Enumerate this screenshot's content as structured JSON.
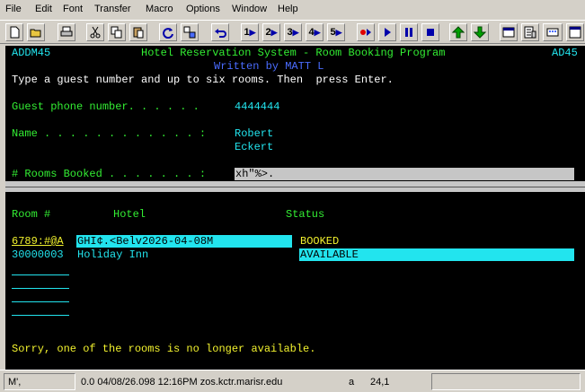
{
  "menu": [
    "File",
    "Edit",
    "Font",
    "Transfer",
    "Macro",
    "Options",
    "Window",
    "Help"
  ],
  "toolbar": {
    "macro_buttons": [
      "1",
      "2",
      "3",
      "4",
      "5"
    ]
  },
  "terminal": {
    "screen_id_left": "ADDM45",
    "title": "Hotel Reservation System - Room Booking Program",
    "screen_id_right": "AD45",
    "author": "Written by MATT L",
    "instruction": "Type a guest number and up to six rooms. Then  press Enter.",
    "guest_phone_label": "Guest phone number. . . . . .",
    "guest_phone_value": "4444444",
    "name_label": "Name . . . . . . . . . . . . :",
    "name_first": "Robert",
    "name_last": "Eckert",
    "rooms_booked_label": "# Rooms Booked . . . . . . . :",
    "rooms_booked_value": "xh\"%>.",
    "col_room": "Room #",
    "col_hotel": "Hotel",
    "col_status": "Status",
    "rows": [
      {
        "room": "6789:#@A",
        "hotel": "GHI¢.<Belv2026-04-08M",
        "status": "BOOKED"
      },
      {
        "room": "30000003",
        "hotel": "Holiday Inn",
        "status": "AVAILABLE"
      }
    ],
    "message": "Sorry, one of the rooms is no longer available."
  },
  "status_bar": {
    "mode": "M',",
    "session_info": "0.0 04/08/26.098 12:16PM zos.kctr.marisr.edu",
    "keyboard": "a",
    "cursor": "24,1"
  },
  "colors": {
    "screen_bg": "#000000",
    "field_green": "#33ee33",
    "data_cyan": "#22e4ee",
    "author_blue": "#4a6cff",
    "message_yellow": "#f2f22e"
  }
}
